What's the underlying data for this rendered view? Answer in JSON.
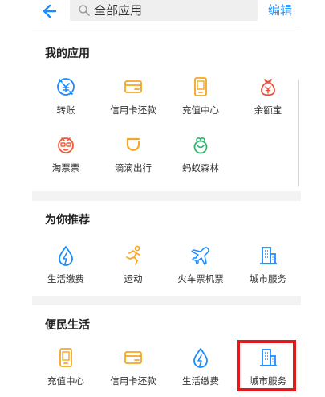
{
  "header": {
    "back_icon": "back-arrow-icon",
    "search_text": "全部应用",
    "edit_label": "编辑"
  },
  "sections": [
    {
      "title": "我的应用",
      "apps": [
        {
          "label": "转账",
          "icon": "transfer-icon",
          "color": "#1a8cff"
        },
        {
          "label": "信用卡还款",
          "icon": "credit-card-icon",
          "color": "#f5a623"
        },
        {
          "label": "充值中心",
          "icon": "phone-recharge-icon",
          "color": "#f5a623"
        },
        {
          "label": "余额宝",
          "icon": "money-bag-icon",
          "color": "#e94e3c"
        },
        {
          "label": "淘票票",
          "icon": "taopiaopiao-icon",
          "color": "#ef5a3a"
        },
        {
          "label": "滴滴出行",
          "icon": "didi-icon",
          "color": "#f5a623"
        },
        {
          "label": "蚂蚁森林",
          "icon": "ant-forest-icon",
          "color": "#2fb56b"
        }
      ]
    },
    {
      "title": "为你推荐",
      "apps": [
        {
          "label": "生活缴费",
          "icon": "utility-drop-icon",
          "color": "#1a8cff"
        },
        {
          "label": "运动",
          "icon": "running-icon",
          "color": "#f5a623"
        },
        {
          "label": "火车票机票",
          "icon": "airplane-icon",
          "color": "#1a8cff"
        },
        {
          "label": "城市服务",
          "icon": "city-building-icon",
          "color": "#1a8cff"
        }
      ]
    },
    {
      "title": "便民生活",
      "apps": [
        {
          "label": "充值中心",
          "icon": "phone-recharge-icon",
          "color": "#f5a623"
        },
        {
          "label": "信用卡还款",
          "icon": "credit-card-icon",
          "color": "#f5a623"
        },
        {
          "label": "生活缴费",
          "icon": "utility-drop-icon",
          "color": "#1a8cff"
        },
        {
          "label": "城市服务",
          "icon": "city-building-icon",
          "color": "#1a8cff"
        }
      ]
    }
  ],
  "colors": {
    "accent": "#1a8cff",
    "highlight": "#e1181c"
  }
}
